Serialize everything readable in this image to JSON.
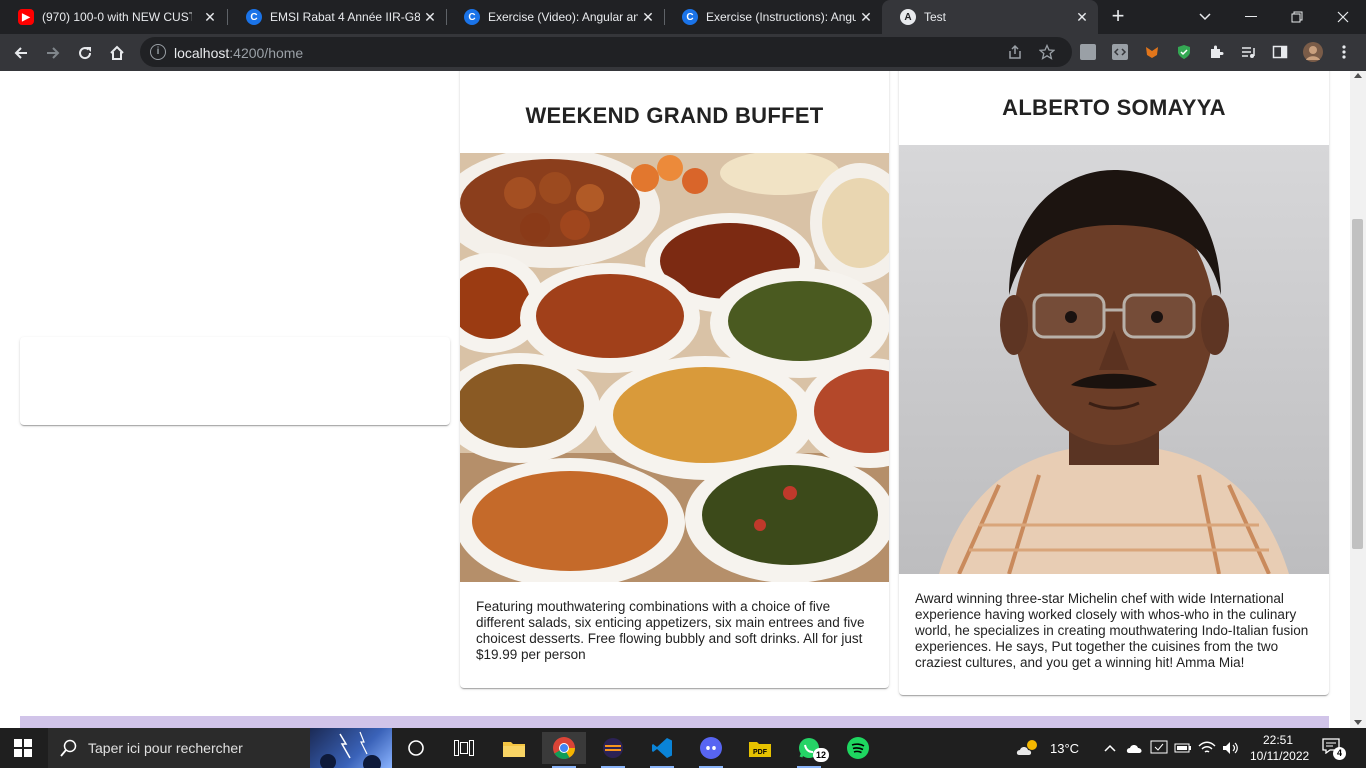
{
  "browser": {
    "tabs": [
      {
        "title": "(970) 100-0 with NEW CUSTO",
        "favicon": "youtube-icon",
        "active": false
      },
      {
        "title": "EMSI Rabat 4 Année IIR-G8 2",
        "favicon": "coursera-icon",
        "active": false
      },
      {
        "title": "Exercise (Video): Angular and",
        "favicon": "coursera-icon",
        "active": false
      },
      {
        "title": "Exercise (Instructions): Angul",
        "favicon": "coursera-icon",
        "active": false
      },
      {
        "title": "Test",
        "favicon": "angular-icon",
        "active": true
      }
    ],
    "address": {
      "host": "localhost",
      "path": ":4200/home"
    }
  },
  "page": {
    "dish": {
      "name": "WEEKEND GRAND BUFFET",
      "image": "buffet-photo",
      "description": "Featuring mouthwatering combinations with a choice of five different salads, six enticing appetizers, six main entrees and five choicest desserts. Free flowing bubbly and soft drinks. All for just $19.99 per person"
    },
    "leader": {
      "name": "ALBERTO SOMAYYA",
      "image": "chef-portrait-photo",
      "description": "Award winning three-star Michelin chef with wide International experience having worked closely with whos-who in the culinary world, he specializes in creating mouthwatering Indo-Italian fusion experiences. He says, Put together the cuisines from the two craziest cultures, and you get a winning hit! Amma Mia!"
    },
    "footer_color": "#d1c4e9"
  },
  "taskbar": {
    "search_placeholder": "Taper ici pour rechercher",
    "weather": "13°C",
    "time": "22:51",
    "date": "10/11/2022",
    "notification_count": "4",
    "whatsapp_badge": "12"
  }
}
